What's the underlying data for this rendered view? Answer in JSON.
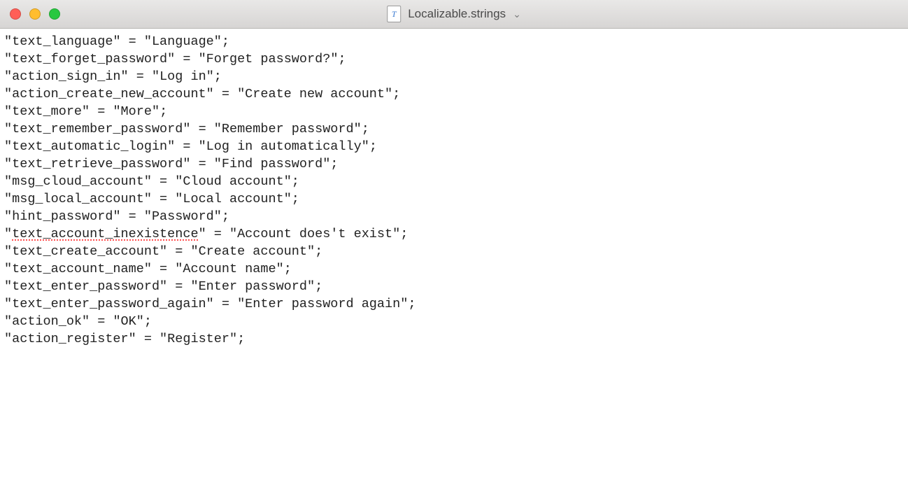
{
  "window": {
    "title": "Localizable.strings"
  },
  "lines": [
    {
      "key": "text_language",
      "value": "Language",
      "spellerr": false
    },
    {
      "key": "text_forget_password",
      "value": "Forget password?",
      "spellerr": false
    },
    {
      "key": "action_sign_in",
      "value": "Log in",
      "spellerr": false
    },
    {
      "key": "action_create_new_account",
      "value": "Create new account",
      "spellerr": false
    },
    {
      "key": "text_more",
      "value": "More",
      "spellerr": false
    },
    {
      "key": "text_remember_password",
      "value": "Remember password",
      "spellerr": false
    },
    {
      "key": "text_automatic_login",
      "value": "Log in automatically",
      "spellerr": false
    },
    {
      "key": "text_retrieve_password",
      "value": "Find password",
      "spellerr": false
    },
    {
      "key": "msg_cloud_account",
      "value": "Cloud account",
      "spellerr": false
    },
    {
      "key": "msg_local_account",
      "value": "Local account",
      "spellerr": false
    },
    {
      "key": "hint_password",
      "value": "Password",
      "spellerr": false
    },
    {
      "key": "text_account_inexistence",
      "value": "Account does't exist",
      "spellerr": true
    },
    {
      "key": "text_create_account",
      "value": "Create account",
      "spellerr": false
    },
    {
      "key": "text_account_name",
      "value": "Account name",
      "spellerr": false
    },
    {
      "key": "text_enter_password",
      "value": "Enter password",
      "spellerr": false
    },
    {
      "key": "text_enter_password_again",
      "value": "Enter password again",
      "spellerr": false
    },
    {
      "key": "action_ok",
      "value": "OK",
      "spellerr": false
    },
    {
      "key": "action_register",
      "value": "Register",
      "spellerr": false
    }
  ]
}
